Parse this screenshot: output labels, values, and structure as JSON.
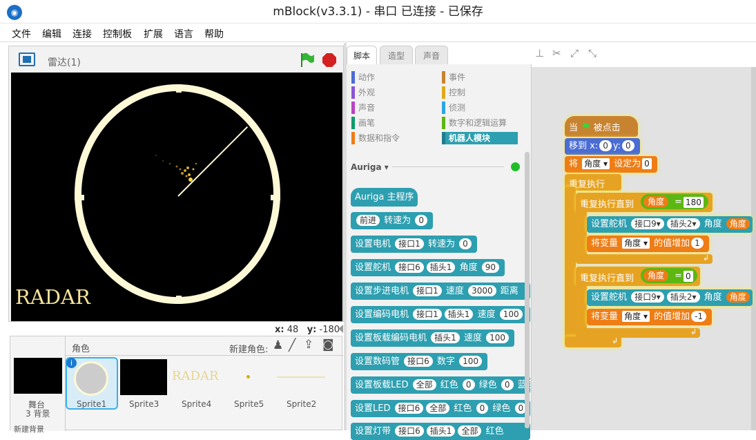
{
  "window": {
    "title": "mBlock(v3.3.1) - 串口 已连接 - 已保存"
  },
  "menu": [
    "文件",
    "编辑",
    "连接",
    "控制板",
    "扩展",
    "语言",
    "帮助"
  ],
  "stage": {
    "name": "雷达(1)",
    "radar_label": "RADAR",
    "x_label": "x:",
    "x_value": "48",
    "y_label": "y:",
    "y_value": "-180"
  },
  "sprites": {
    "header": "角色",
    "new_sprite": "新建角色:",
    "stage_label": "舞台",
    "backdrops": "3 背景",
    "new_backdrop": "新建背景",
    "items": [
      {
        "name": "Sprite1"
      },
      {
        "name": "Sprite3"
      },
      {
        "name": "Sprite4",
        "thumb": "RADAR"
      },
      {
        "name": "Sprite5"
      },
      {
        "name": "Sprite2"
      }
    ]
  },
  "tabs": [
    "脚本",
    "造型",
    "声音"
  ],
  "categories": [
    {
      "label": "动作",
      "color": "#4a6cd4"
    },
    {
      "label": "事件",
      "color": "#c88330"
    },
    {
      "label": "外观",
      "color": "#8a55d7"
    },
    {
      "label": "控制",
      "color": "#e1a91a"
    },
    {
      "label": "声音",
      "color": "#bb42c3"
    },
    {
      "label": "侦测",
      "color": "#2ca5e2"
    },
    {
      "label": "画笔",
      "color": "#0e9a6c"
    },
    {
      "label": "数字和逻辑运算",
      "color": "#5cb712"
    },
    {
      "label": "数据和指令",
      "color": "#ee7d16"
    },
    {
      "label": "机器人模块",
      "color": "#2d9fb0"
    }
  ],
  "palette": {
    "extension": "Auriga",
    "hat": "Auriga 主程序",
    "blocks": [
      {
        "text": "转速为",
        "a": "前进",
        "b": "0"
      },
      {
        "text": "设置电机",
        "a": "接口1",
        "b": "转速为",
        "c": "0"
      },
      {
        "text": "设置舵机",
        "a": "接口6",
        "b": "插头1",
        "c": "角度",
        "d": "90"
      },
      {
        "text": "设置步进电机",
        "a": "接口1",
        "b": "速度",
        "c": "3000",
        "d": "距离"
      },
      {
        "text": "设置编码电机",
        "a": "接口1",
        "b": "插头1",
        "c": "速度",
        "d": "100"
      },
      {
        "text": "设置板载编码电机",
        "a": "插头1",
        "b": "速度",
        "c": "100"
      },
      {
        "text": "设置数码管",
        "a": "接口6",
        "b": "数字",
        "c": "100"
      },
      {
        "text": "设置板载LED",
        "a": "全部",
        "b": "红色",
        "c": "0",
        "d": "绿色",
        "e": "0",
        "f": "蓝色"
      },
      {
        "text": "设置LED",
        "a": "接口6",
        "b": "全部",
        "c": "红色",
        "d": "0",
        "e": "绿色",
        "f": "0"
      },
      {
        "text": "设置灯带",
        "a": "接口6",
        "b": "插头1",
        "c": "全部",
        "d": "红色"
      }
    ]
  },
  "script": {
    "when": "当",
    "clicked": "被点击",
    "move": "移到 x:",
    "x": "0",
    "y_lbl": "y:",
    "y": "0",
    "set": "将",
    "var": "角度",
    "set_to": "设定为",
    "set_val": "0",
    "forever": "重复执行",
    "repeat_until": "重复执行直到",
    "eq": "=",
    "target1": "180",
    "target2": "0",
    "servo": "设置舵机",
    "port": "接口9",
    "plug": "插头2",
    "angle": "角度",
    "change": "将变量",
    "change_by": "的值增加",
    "inc": "1",
    "dec": "-1"
  }
}
